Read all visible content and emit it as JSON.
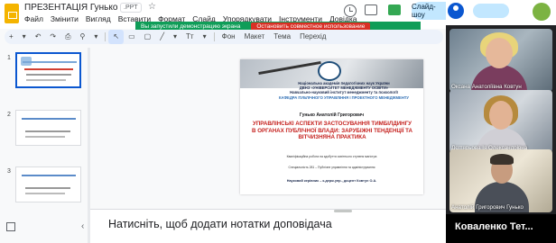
{
  "doc": {
    "title": "ПРЕЗЕНТАЦІЯ Гунько Г.А.",
    "badge": ".PPT",
    "menu": [
      "Файл",
      "Змінити",
      "Вигляд",
      "Вставити",
      "Формат",
      "Слайд",
      "Упорядкувати",
      "Інструменти",
      "Довідка"
    ]
  },
  "banner": {
    "message": "Вы запустили демонстрацию экрана",
    "stop_label": "Остановить совместное использование"
  },
  "actions": {
    "slideshow_label": "Слайд-шоу"
  },
  "toolbar": {
    "items": [
      "+",
      "▾",
      "↶",
      "↷",
      "⎙",
      "⚲",
      "▾",
      "↖",
      "▭",
      "▢",
      "╱",
      "▾",
      "Tт",
      "▾",
      "Фон",
      "Макет",
      "Тема",
      "Перехід"
    ]
  },
  "filmstrip": {
    "slides": [
      {
        "num": "1",
        "selected": true
      },
      {
        "num": "2",
        "selected": false
      },
      {
        "num": "3",
        "selected": false
      }
    ]
  },
  "slide": {
    "academy": "Національна академія педагогічних наук України",
    "university": "ДВНЗ «УНІВЕРСИТЕТ МЕНЕДЖМЕНТУ ОСВІТИ»",
    "institute": "Навчально-науковий інститут менеджменту та психології",
    "department": "КАФЕДРА ПУБЛІЧНОГО УПРАВЛІННЯ І ПРОЕКТНОГО МЕНЕДЖМЕНТУ",
    "author": "Гунько Анатолій Григорович",
    "topic": "УПРАВЛІНСЬКІ АСПЕКТИ ЗАСТОСУВАННЯ ТИМБІЛДИНГУ В ОРГАНАХ ПУБЛІЧНОЇ ВЛАДИ: ЗАРУБІЖНІ ТЕНДЕНЦІЇ ТА ВІТЧИЗНЯНА ПРАКТИКА",
    "work_type": "Кваліфікаційна робота на здобуття освітнього ступеня магістра",
    "specialty": "Спеціальність 281 – Публічне управління та адміністрування",
    "supervisor": "Науковий керівник – к.держ.упр., доцент Ковтун О.А."
  },
  "notes": {
    "placeholder": "Натисніть, щоб додати нотатки доповідача"
  },
  "meet": {
    "participants": [
      {
        "name": "Оксана Анатоліївна Ковтун"
      },
      {
        "name": "Дєгтярьова Ія Олександрівна"
      },
      {
        "name": "Анатолій Григорович Гунько"
      }
    ],
    "presenter": "Коваленко Тет..."
  }
}
